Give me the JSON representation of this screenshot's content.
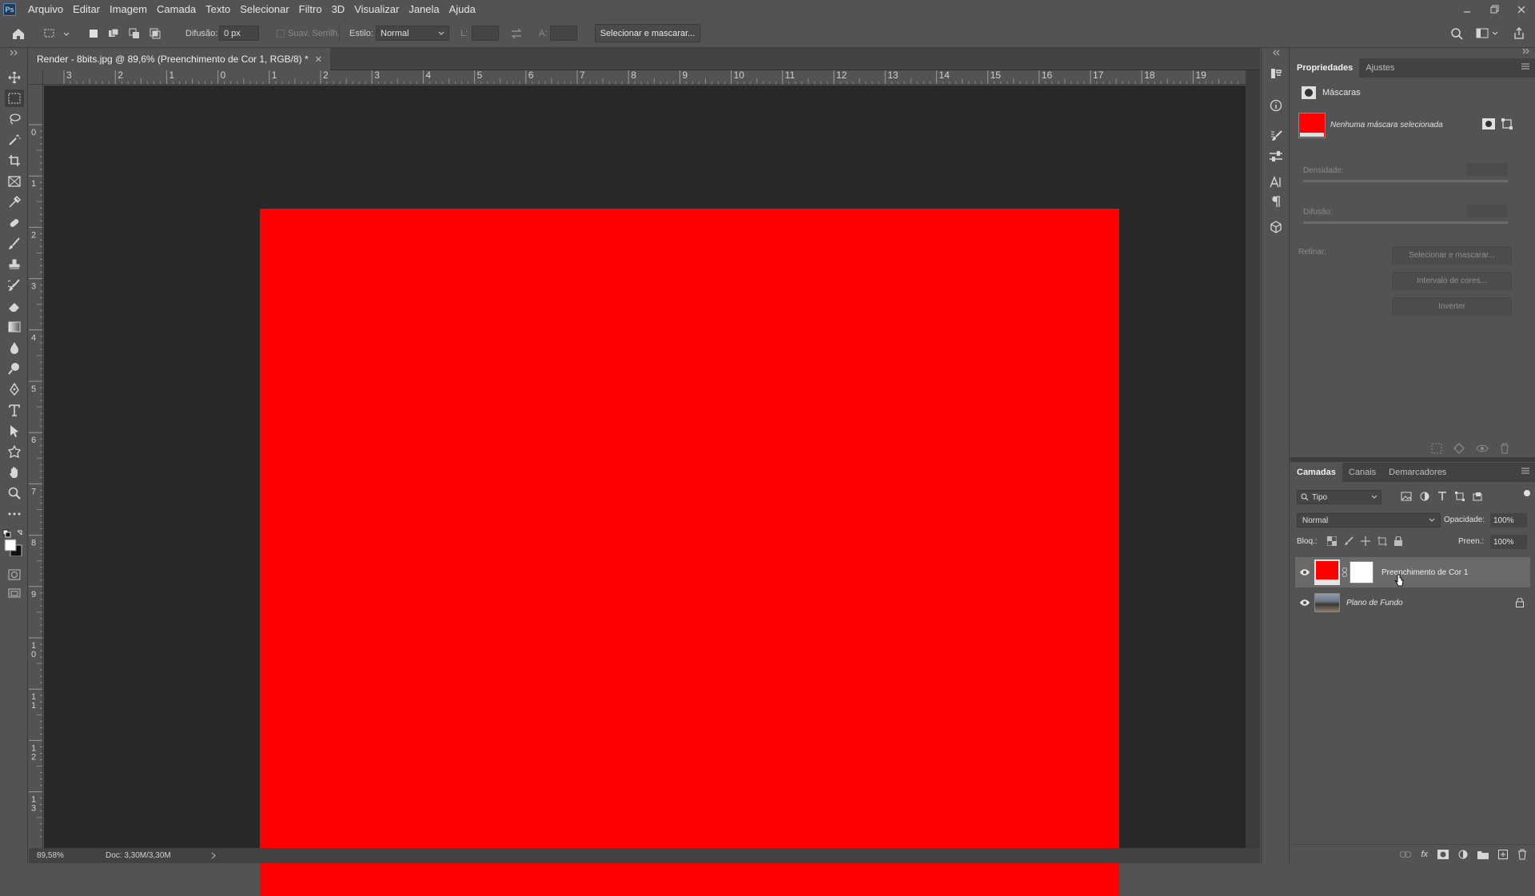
{
  "app": {
    "logo_text": "Ps"
  },
  "menu": [
    "Arquivo",
    "Editar",
    "Imagem",
    "Camada",
    "Texto",
    "Selecionar",
    "Filtro",
    "3D",
    "Visualizar",
    "Janela",
    "Ajuda"
  ],
  "options": {
    "feather_label": "Difusão:",
    "feather_value": "0 px",
    "antialias_label": "Suav. Serrilh.",
    "style_label": "Estilo:",
    "style_value": "Normal",
    "width_label": "L:",
    "height_label": "A:",
    "select_mask_button": "Selecionar e mascarar..."
  },
  "document": {
    "tab_title": "Render - 8bits.jpg @ 89,6% (Preenchimento de Cor 1, RGB/8) *",
    "canvas_color": "#ff0000",
    "ruler_top_labels": [
      "3",
      "2",
      "1",
      "0",
      "1",
      "2",
      "3",
      "4",
      "5",
      "6",
      "7",
      "8",
      "9",
      "10",
      "11",
      "12",
      "13",
      "14",
      "15",
      "16",
      "17",
      "18",
      "19"
    ],
    "ruler_left_labels": [
      "0",
      "1",
      "2",
      "3",
      "4",
      "5",
      "6",
      "7",
      "8",
      "9",
      "1\n0",
      "1\n1",
      "1\n2",
      "1\n3"
    ]
  },
  "status": {
    "zoom": "89,58%",
    "doc_size": "Doc: 3,30M/3,30M"
  },
  "properties_panel": {
    "tabs": [
      "Propriedades",
      "Ajustes"
    ],
    "section_label": "Máscaras",
    "mask_status": "Nenhuma máscara selecionada",
    "density_label": "Densidade:",
    "feather_label": "Difusão:",
    "refine_label": "Refinar:",
    "buttons": [
      "Selecionar e mascarar...",
      "Intervalo de cores...",
      "Inverter"
    ]
  },
  "layers_panel": {
    "tabs": [
      "Camadas",
      "Canais",
      "Demarcadores"
    ],
    "filter_kind": "Tipo",
    "blend_mode": "Normal",
    "opacity_label": "Opacidade:",
    "opacity_value": "100%",
    "lock_label": "Bloq.:",
    "fill_label": "Preen.:",
    "fill_value": "100%",
    "layers": [
      {
        "name": "Preenchimento de Cor 1",
        "swatch": "#ff0000",
        "selected": true
      },
      {
        "name": "Plano de Fundo",
        "locked": true
      }
    ]
  }
}
